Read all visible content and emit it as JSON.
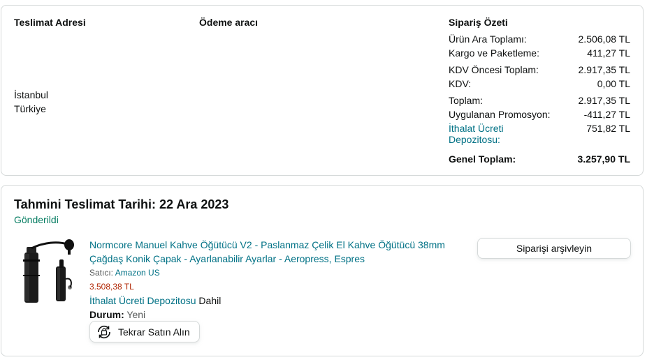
{
  "summary": {
    "shipping_address_title": "Teslimat Adresi",
    "address_line1": "İstanbul",
    "address_line2": "Türkiye",
    "payment_title": "Ödeme aracı",
    "order_summary_title": "Sipariş Özeti",
    "rows": [
      {
        "label": "Ürün Ara Toplamı:",
        "value": "2.506,08 TL"
      },
      {
        "label": "Kargo ve Paketleme:",
        "value": "411,27 TL"
      },
      {
        "label": "KDV Öncesi Toplam:",
        "value": "2.917,35 TL"
      },
      {
        "label": "KDV:",
        "value": "0,00 TL"
      },
      {
        "label": "Toplam:",
        "value": "2.917,35 TL"
      },
      {
        "label": "Uygulanan Promosyon:",
        "value": "-411,27 TL"
      },
      {
        "label_line1": "İthalat Ücreti",
        "label_line2": "Depozitosu:",
        "value": "751,82 TL"
      }
    ],
    "grand_total_label": "Genel Toplam:",
    "grand_total_value": "3.257,90 TL"
  },
  "shipment": {
    "delivery_estimate": "Tahmini Teslimat Tarihi: 22 Ara 2023",
    "status": "Gönderildi",
    "product": {
      "title_line1": "Normcore Manuel Kahve Öğütücü V2 - Paslanmaz Çelik El Kahve Öğütücü 38mm",
      "title_line2": "Çağdaş Konik Çapak - Ayarlanabilir Ayarlar - Aeropress, Espres",
      "seller_label": "Satıcı:",
      "seller_name": "Amazon US",
      "price": "3.508,38 TL",
      "import_fee_link": "İthalat Ücreti Depozitosu",
      "import_fee_suffix": "Dahil",
      "condition_label": "Durum:",
      "condition_value": "Yeni"
    },
    "buy_again_label": "Tekrar Satın Alın",
    "archive_label": "Siparişi arşivleyin"
  },
  "colors": {
    "link": "#007185",
    "status_green": "#067d62",
    "price_red": "#b12704",
    "border": "#d5d9d9"
  }
}
